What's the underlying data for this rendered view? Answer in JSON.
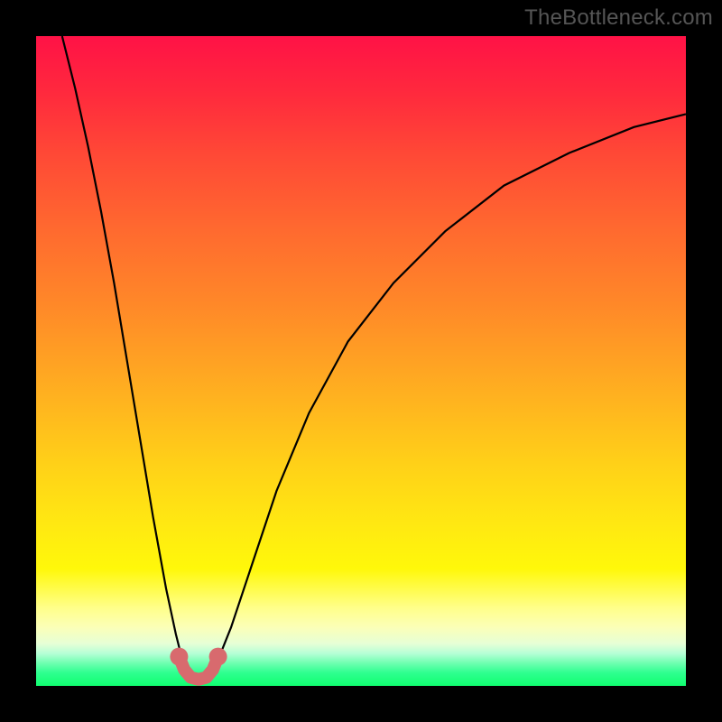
{
  "watermark": "TheBottleneck.com",
  "chart_data": {
    "type": "line",
    "title": "",
    "xlabel": "",
    "ylabel": "",
    "xlim": [
      0,
      100
    ],
    "ylim": [
      0,
      100
    ],
    "grid": false,
    "legend": false,
    "annotations": [],
    "background_gradient_stops": [
      {
        "pct": 0,
        "color": "#ff1246"
      },
      {
        "pct": 30,
        "color": "#ff6a2f"
      },
      {
        "pct": 66,
        "color": "#ffd118"
      },
      {
        "pct": 88,
        "color": "#ffff8a"
      },
      {
        "pct": 100,
        "color": "#10ff70"
      }
    ],
    "series": [
      {
        "name": "left-branch",
        "stroke": "#000000",
        "x": [
          4.0,
          6.0,
          8.0,
          10.0,
          12.0,
          14.0,
          16.0,
          18.0,
          20.0,
          21.5,
          22.5,
          23.2
        ],
        "y": [
          100,
          92,
          83,
          73,
          62,
          50,
          38,
          26,
          15,
          8,
          4,
          2
        ]
      },
      {
        "name": "right-branch",
        "stroke": "#000000",
        "x": [
          26.8,
          28.0,
          30.0,
          33.0,
          37.0,
          42.0,
          48.0,
          55.0,
          63.0,
          72.0,
          82.0,
          92.0,
          100.0
        ],
        "y": [
          2,
          4,
          9,
          18,
          30,
          42,
          53,
          62,
          70,
          77,
          82,
          86,
          88
        ]
      },
      {
        "name": "bottleneck-marker",
        "stroke": "#d86a6e",
        "x": [
          22.0,
          22.8,
          23.8,
          25.0,
          26.2,
          27.2,
          28.0
        ],
        "y": [
          4.5,
          2.5,
          1.3,
          1.0,
          1.3,
          2.5,
          4.5
        ]
      }
    ],
    "minimum_point": {
      "x": 25.0,
      "y": 1.0
    }
  }
}
